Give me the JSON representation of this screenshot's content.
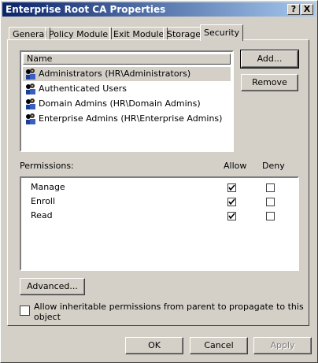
{
  "window": {
    "title": "Enterprise Root CA Properties"
  },
  "titlebar_buttons": {
    "help": "?",
    "close": "X"
  },
  "tabs": [
    {
      "label": "General"
    },
    {
      "label": "Policy Module"
    },
    {
      "label": "Exit Module"
    },
    {
      "label": "Storage"
    },
    {
      "label": "Security"
    }
  ],
  "users": {
    "column_header": "Name",
    "items": [
      {
        "label": "Administrators (HR\\Administrators)",
        "selected": true
      },
      {
        "label": "Authenticated Users"
      },
      {
        "label": "Domain Admins (HR\\Domain Admins)"
      },
      {
        "label": "Enterprise Admins (HR\\Enterprise Admins)"
      }
    ]
  },
  "buttons": {
    "add": "Add...",
    "remove": "Remove",
    "advanced": "Advanced...",
    "ok": "OK",
    "cancel": "Cancel",
    "apply": "Apply"
  },
  "permissions": {
    "label": "Permissions:",
    "allow_header": "Allow",
    "deny_header": "Deny",
    "rows": [
      {
        "name": "Manage",
        "allow": true,
        "deny": false
      },
      {
        "name": "Enroll",
        "allow": true,
        "deny": false
      },
      {
        "name": "Read",
        "allow": true,
        "deny": false
      }
    ]
  },
  "inherit": {
    "line1": "Allow inheritable permissions from parent to propagate to this",
    "line2": "object",
    "checked": false
  }
}
